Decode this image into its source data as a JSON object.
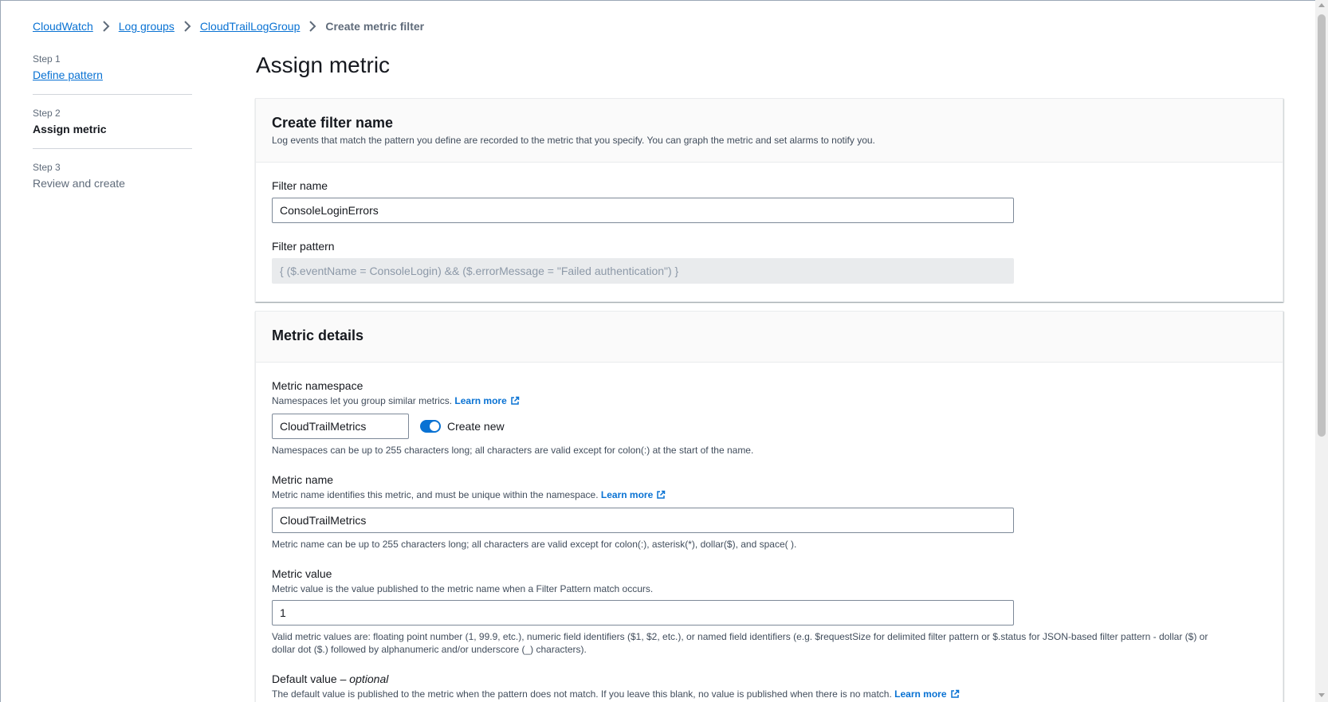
{
  "breadcrumb": {
    "items": [
      "CloudWatch",
      "Log groups",
      "CloudTrailLogGroup"
    ],
    "current": "Create metric filter"
  },
  "steps": [
    {
      "label": "Step 1",
      "title": "Define pattern"
    },
    {
      "label": "Step 2",
      "title": "Assign metric"
    },
    {
      "label": "Step 3",
      "title": "Review and create"
    }
  ],
  "page": {
    "title": "Assign metric"
  },
  "filter_section": {
    "title": "Create filter name",
    "description": "Log events that match the pattern you define are recorded to the metric that you specify. You can graph the metric and set alarms to notify you.",
    "filter_name_label": "Filter name",
    "filter_name_value": "ConsoleLoginErrors",
    "filter_pattern_label": "Filter pattern",
    "filter_pattern_value": "{ ($.eventName = ConsoleLogin) && ($.errorMessage = \"Failed authentication\") }"
  },
  "metric_section": {
    "title": "Metric details",
    "namespace": {
      "label": "Metric namespace",
      "description": "Namespaces let you group similar metrics.",
      "learn_more": "Learn more",
      "value": "CloudTrailMetrics",
      "toggle_label": "Create new",
      "toggle_on": true,
      "constraint": "Namespaces can be up to 255 characters long; all characters are valid except for colon(:) at the start of the name."
    },
    "metric_name": {
      "label": "Metric name",
      "description": "Metric name identifies this metric, and must be unique within the namespace.",
      "learn_more": "Learn more",
      "value": "CloudTrailMetrics",
      "constraint": "Metric name can be up to 255 characters long; all characters are valid except for colon(:), asterisk(*), dollar($), and space( )."
    },
    "metric_value": {
      "label": "Metric value",
      "description": "Metric value is the value published to the metric name when a Filter Pattern match occurs.",
      "value": "1",
      "constraint_line1": "Valid metric values are: floating point number (1, 99.9, etc.), numeric field identifiers ($1, $2, etc.), or named field identifiers (e.g. $requestSize for delimited filter pattern or $.status for JSON-based filter pattern - dollar ($) or",
      "constraint_line2": "dollar dot ($.) followed by alphanumeric and/or underscore (_) characters)."
    },
    "default_value": {
      "label": "Default value",
      "optional": "optional",
      "description": "The default value is published to the metric when the pattern does not match. If you leave this blank, no value is published when there is no match.",
      "learn_more": "Learn more"
    }
  },
  "colors": {
    "link": "#0972d3",
    "text": "#16191f",
    "muted": "#5f6b7a",
    "toggle": "#0972d3"
  }
}
